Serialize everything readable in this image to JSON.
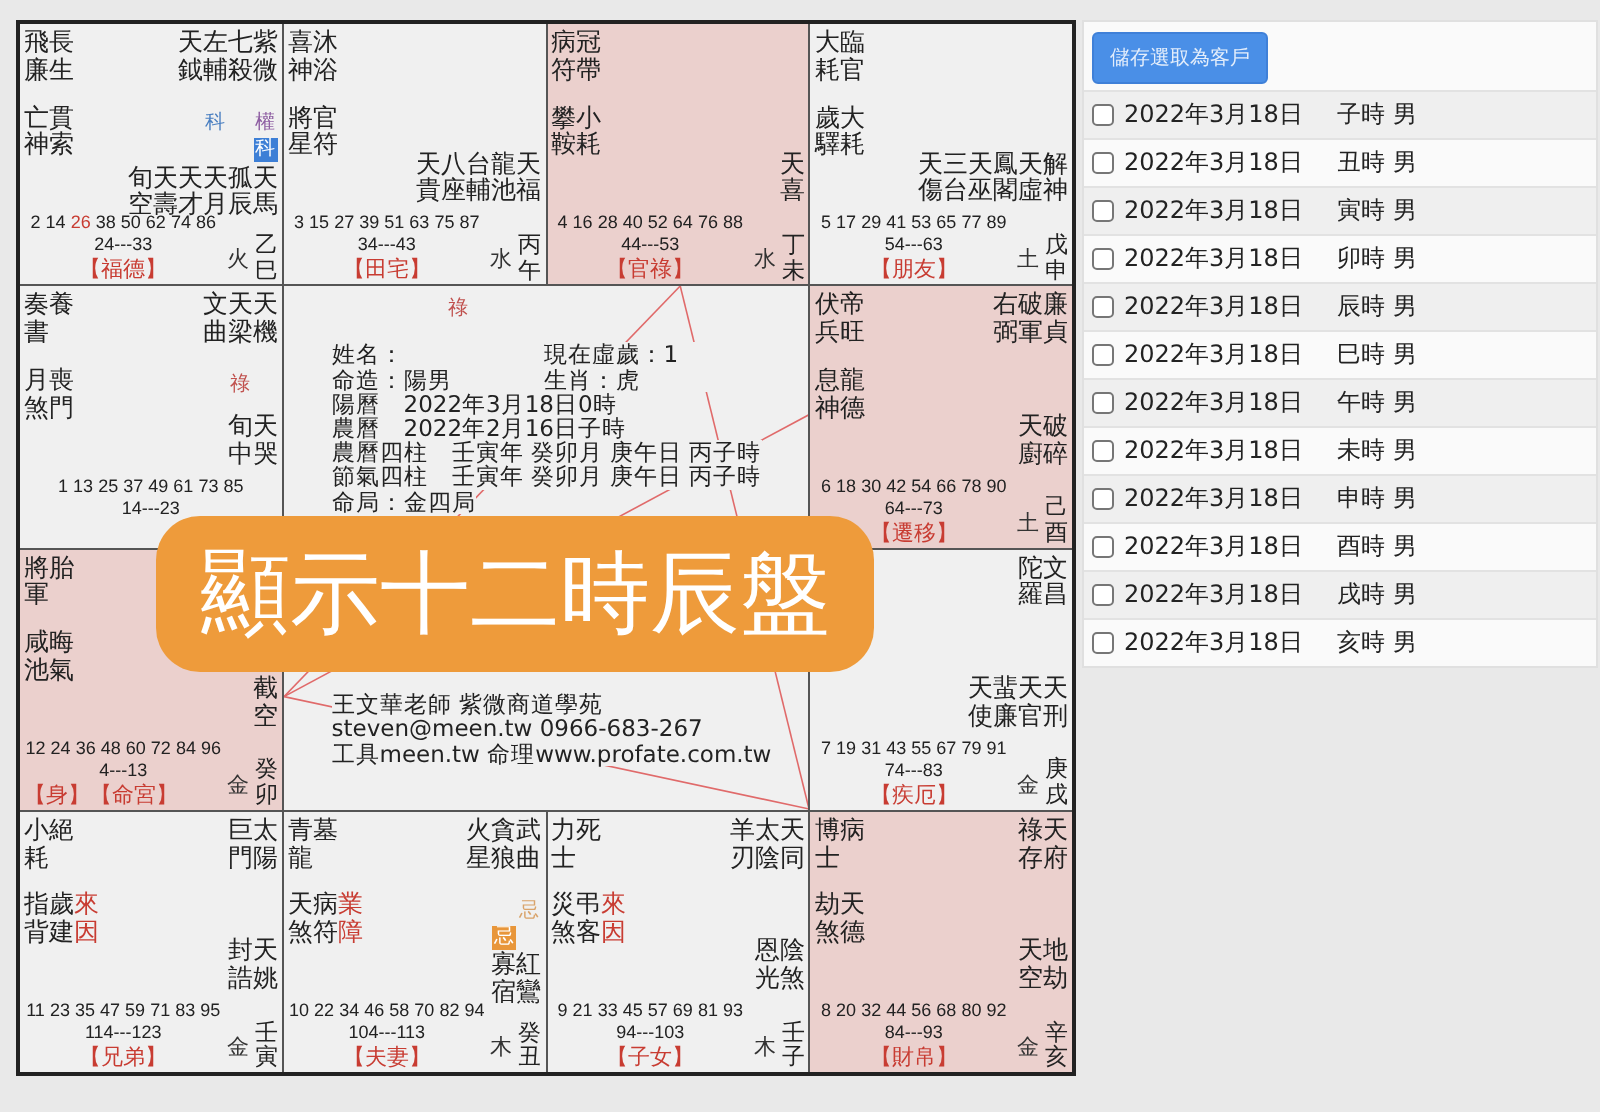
{
  "chart": {
    "palaces": [
      {
        "highlighted": false,
        "left_top": [
          "飛廉",
          "長生"
        ],
        "left_mid": [
          {
            "text": "亡神",
            "kind": "plain"
          },
          {
            "text": "貫索",
            "kind": "plain"
          }
        ],
        "main_stars": [
          {
            "name": "天鉞"
          },
          {
            "name": "左輔",
            "birth_mark": {
              "text": "科",
              "color": "#4a7fc1"
            }
          },
          {
            "name": "七殺"
          },
          {
            "name": "紫微",
            "birth_mark": {
              "text": "權",
              "color": "#8e5ea2"
            },
            "palace_mark": {
              "text": "科",
              "color": "#3d7fd6"
            }
          }
        ],
        "minor_stars": [
          "旬空",
          "天壽",
          "天才",
          "天月",
          "孤辰",
          "天馬"
        ],
        "ages": [
          {
            "text": "2",
            "current": false
          },
          {
            "text": "14",
            "current": false
          },
          {
            "text": "26",
            "current": true
          },
          {
            "text": "38",
            "current": false
          },
          {
            "text": "50",
            "current": false
          },
          {
            "text": "62",
            "current": false
          },
          {
            "text": "74",
            "current": false
          },
          {
            "text": "86",
            "current": false
          }
        ],
        "age_range": "24---33",
        "palace": "【福德】",
        "element": "火",
        "ganzhi": "乙巳"
      },
      {
        "highlighted": false,
        "left_top": [
          "喜神",
          "沐浴"
        ],
        "left_mid": [
          {
            "text": "將星",
            "kind": "plain"
          },
          {
            "text": "官符",
            "kind": "plain"
          }
        ],
        "minor_stars": [
          "天貴",
          "八座",
          "台輔",
          "龍池",
          "天福"
        ],
        "ages": [
          {
            "text": "3",
            "current": false
          },
          {
            "text": "15",
            "current": false
          },
          {
            "text": "27",
            "current": false
          },
          {
            "text": "39",
            "current": false
          },
          {
            "text": "51",
            "current": false
          },
          {
            "text": "63",
            "current": false
          },
          {
            "text": "75",
            "current": false
          },
          {
            "text": "87",
            "current": false
          }
        ],
        "age_range": "34---43",
        "palace": "【田宅】",
        "element": "水",
        "ganzhi": "丙午"
      },
      {
        "highlighted": true,
        "left_top": [
          "病符",
          "冠帶"
        ],
        "left_mid": [
          {
            "text": "攀鞍",
            "kind": "plain"
          },
          {
            "text": "小耗",
            "kind": "plain"
          }
        ],
        "minor_stars": [
          "天喜"
        ],
        "ages": [
          {
            "text": "4",
            "current": false
          },
          {
            "text": "16",
            "current": false
          },
          {
            "text": "28",
            "current": false
          },
          {
            "text": "40",
            "current": false
          },
          {
            "text": "52",
            "current": false
          },
          {
            "text": "64",
            "current": false
          },
          {
            "text": "76",
            "current": false
          },
          {
            "text": "88",
            "current": false
          }
        ],
        "age_range": "44---53",
        "palace": "【官祿】",
        "element": "水",
        "ganzhi": "丁未"
      },
      {
        "highlighted": false,
        "left_top": [
          "大耗",
          "臨官"
        ],
        "left_mid": [
          {
            "text": "歲驛",
            "kind": "plain"
          },
          {
            "text": "大耗",
            "kind": "plain"
          }
        ],
        "minor_stars": [
          "天傷",
          "三台",
          "天巫",
          "鳳閣",
          "天虛",
          "解神"
        ],
        "ages": [
          {
            "text": "5",
            "current": false
          },
          {
            "text": "17",
            "current": false
          },
          {
            "text": "29",
            "current": false
          },
          {
            "text": "41",
            "current": false
          },
          {
            "text": "53",
            "current": false
          },
          {
            "text": "65",
            "current": false
          },
          {
            "text": "77",
            "current": false
          },
          {
            "text": "89",
            "current": false
          }
        ],
        "age_range": "54---63",
        "palace": "【朋友】",
        "element": "土",
        "ganzhi": "戊申"
      },
      {
        "highlighted": false,
        "left_top": [
          "奏書",
          "養"
        ],
        "left_mid": [
          {
            "text": "月煞",
            "kind": "plain"
          },
          {
            "text": "喪門",
            "kind": "plain"
          }
        ],
        "main_stars": [
          {
            "name": "文曲"
          },
          {
            "name": "天梁",
            "birth_mark": {
              "text": "祿",
              "color": "#c0504d"
            }
          },
          {
            "name": "天機"
          }
        ],
        "minor_stars": [
          "旬中",
          "天哭"
        ],
        "ages": [
          {
            "text": "1",
            "current": false
          },
          {
            "text": "13",
            "current": false
          },
          {
            "text": "25",
            "current": false
          },
          {
            "text": "37",
            "current": false
          },
          {
            "text": "49",
            "current": false
          },
          {
            "text": "61",
            "current": false
          },
          {
            "text": "73",
            "current": false
          },
          {
            "text": "85",
            "current": false
          }
        ],
        "age_range": "14---23"
      },
      {
        "highlighted": true,
        "left_top": [
          "伏兵",
          "帝旺"
        ],
        "left_mid": [
          {
            "text": "息神",
            "kind": "plain"
          },
          {
            "text": "龍德",
            "kind": "plain"
          }
        ],
        "main_stars": [
          {
            "name": "右弼"
          },
          {
            "name": "破軍"
          },
          {
            "name": "廉貞"
          }
        ],
        "minor_stars": [
          "天廚",
          "破碎"
        ],
        "ages": [
          {
            "text": "6",
            "current": false
          },
          {
            "text": "18",
            "current": false
          },
          {
            "text": "30",
            "current": false
          },
          {
            "text": "42",
            "current": false
          },
          {
            "text": "54",
            "current": false
          },
          {
            "text": "66",
            "current": false
          },
          {
            "text": "78",
            "current": false
          },
          {
            "text": "90",
            "current": false
          }
        ],
        "age_range": "64---73",
        "palace": "【遷移】",
        "element": "土",
        "ganzhi": "己酉"
      },
      {
        "highlighted": true,
        "left_top": [
          "將軍",
          "胎"
        ],
        "left_mid": [
          {
            "text": "咸池",
            "kind": "plain"
          },
          {
            "text": "晦氣",
            "kind": "plain"
          }
        ],
        "minor_stars": [
          "截空"
        ],
        "ages": [
          {
            "text": "12",
            "current": false
          },
          {
            "text": "24",
            "current": false
          },
          {
            "text": "36",
            "current": false
          },
          {
            "text": "48",
            "current": false
          },
          {
            "text": "60",
            "current": false
          },
          {
            "text": "72",
            "current": false
          },
          {
            "text": "84",
            "current": false
          },
          {
            "text": "96",
            "current": false
          }
        ],
        "age_range": "4---13",
        "body_label": "【身】",
        "palace": "【命宮】",
        "element": "金",
        "ganzhi": "癸卯"
      },
      {
        "highlighted": false,
        "main_stars": [
          {
            "name": "陀羅"
          },
          {
            "name": "文昌"
          }
        ],
        "minor_stars": [
          "天使",
          "蜚廉",
          "天官",
          "天刑"
        ],
        "ages": [
          {
            "text": "7",
            "current": false
          },
          {
            "text": "19",
            "current": false
          },
          {
            "text": "31",
            "current": false
          },
          {
            "text": "43",
            "current": false
          },
          {
            "text": "55",
            "current": false
          },
          {
            "text": "67",
            "current": false
          },
          {
            "text": "79",
            "current": false
          },
          {
            "text": "91",
            "current": false
          }
        ],
        "age_range": "74---83",
        "palace": "【疾厄】",
        "element": "金",
        "ganzhi": "庚戌"
      },
      {
        "highlighted": false,
        "left_top": [
          "小耗",
          "絕"
        ],
        "left_mid": [
          {
            "text": "指背",
            "kind": "plain"
          },
          {
            "text": "歲建",
            "kind": "plain"
          },
          {
            "text": "來因",
            "kind": "cause"
          }
        ],
        "main_stars": [
          {
            "name": "巨門"
          },
          {
            "name": "太陽"
          }
        ],
        "minor_stars": [
          "封誥",
          "天姚"
        ],
        "ages": [
          {
            "text": "11",
            "current": false
          },
          {
            "text": "23",
            "current": false
          },
          {
            "text": "35",
            "current": false
          },
          {
            "text": "47",
            "current": false
          },
          {
            "text": "59",
            "current": false
          },
          {
            "text": "71",
            "current": false
          },
          {
            "text": "83",
            "current": false
          },
          {
            "text": "95",
            "current": false
          }
        ],
        "age_range": "114---123",
        "palace": "【兄弟】",
        "element": "金",
        "ganzhi": "壬寅"
      },
      {
        "highlighted": false,
        "left_top": [
          "青龍",
          "墓"
        ],
        "left_mid": [
          {
            "text": "天煞",
            "kind": "plain"
          },
          {
            "text": "病符",
            "kind": "plain"
          },
          {
            "text": "業障",
            "kind": "cause"
          }
        ],
        "main_stars": [
          {
            "name": "火星"
          },
          {
            "name": "貪狼",
            "palace_mark": {
              "text": "忌",
              "color": "#e8963a"
            }
          },
          {
            "name": "武曲",
            "birth_mark": {
              "text": "忌",
              "color": "#d9a36a"
            }
          }
        ],
        "minor_stars": [
          "寡宿",
          "紅鸞"
        ],
        "ages": [
          {
            "text": "10",
            "current": false
          },
          {
            "text": "22",
            "current": false
          },
          {
            "text": "34",
            "current": false
          },
          {
            "text": "46",
            "current": false
          },
          {
            "text": "58",
            "current": false
          },
          {
            "text": "70",
            "current": false
          },
          {
            "text": "82",
            "current": false
          },
          {
            "text": "94",
            "current": false
          }
        ],
        "age_range": "104---113",
        "palace": "【夫妻】",
        "element": "木",
        "ganzhi": "癸丑"
      },
      {
        "highlighted": false,
        "left_top": [
          "力士",
          "死"
        ],
        "left_mid": [
          {
            "text": "災煞",
            "kind": "plain"
          },
          {
            "text": "弔客",
            "kind": "plain"
          },
          {
            "text": "來因",
            "kind": "cause"
          }
        ],
        "main_stars": [
          {
            "name": "羊刃"
          },
          {
            "name": "太陰"
          },
          {
            "name": "天同"
          }
        ],
        "minor_stars": [
          "恩光",
          "陰煞"
        ],
        "ages": [
          {
            "text": "9",
            "current": false
          },
          {
            "text": "21",
            "current": false
          },
          {
            "text": "33",
            "current": false
          },
          {
            "text": "45",
            "current": false
          },
          {
            "text": "57",
            "current": false
          },
          {
            "text": "69",
            "current": false
          },
          {
            "text": "81",
            "current": false
          },
          {
            "text": "93",
            "current": false
          }
        ],
        "age_range": "94---103",
        "palace": "【子女】",
        "element": "木",
        "ganzhi": "壬子"
      },
      {
        "highlighted": true,
        "left_top": [
          "博士",
          "病"
        ],
        "left_mid": [
          {
            "text": "劫煞",
            "kind": "plain"
          },
          {
            "text": "天德",
            "kind": "plain"
          }
        ],
        "main_stars": [
          {
            "name": "祿存"
          },
          {
            "name": "天府"
          }
        ],
        "minor_stars": [
          "天空",
          "地劫"
        ],
        "ages": [
          {
            "text": "8",
            "current": false
          },
          {
            "text": "20",
            "current": false
          },
          {
            "text": "32",
            "current": false
          },
          {
            "text": "44",
            "current": false
          },
          {
            "text": "56",
            "current": false
          },
          {
            "text": "68",
            "current": false
          },
          {
            "text": "80",
            "current": false
          },
          {
            "text": "92",
            "current": false
          }
        ],
        "age_range": "84---93",
        "palace": "【財帛】",
        "element": "金",
        "ganzhi": "辛亥"
      }
    ],
    "center": {
      "top_mark": "祿",
      "header_pairs": [
        {
          "left": "姓名：",
          "right": "現在虛歲：1"
        },
        {
          "left": "命造：陽男",
          "right": "生肖：虎"
        }
      ],
      "details": [
        {
          "label": "陽曆",
          "value": "2022年3月18日0時"
        },
        {
          "label": "農曆",
          "value": "2022年2月16日子時"
        },
        {
          "label": "農曆四柱",
          "value": "壬寅年 癸卯月 庚午日 丙子時"
        },
        {
          "label": "節氣四柱",
          "value": "壬寅年 癸卯月 庚午日 丙子時"
        }
      ],
      "bureau": "命局：金四局",
      "footer": [
        "王文華老師 紫微商道學苑",
        "steven@meen.tw 0966-683-267",
        "工具meen.tw 命理www.profate.com.tw"
      ]
    },
    "banner": "顯示十二時辰盤"
  },
  "side_panel": {
    "save_button": "儲存選取為客戶",
    "rows": [
      {
        "date": "2022年3月18日",
        "hour": "子時 男",
        "checked": false
      },
      {
        "date": "2022年3月18日",
        "hour": "丑時 男",
        "checked": false
      },
      {
        "date": "2022年3月18日",
        "hour": "寅時 男",
        "checked": false
      },
      {
        "date": "2022年3月18日",
        "hour": "卯時 男",
        "checked": false
      },
      {
        "date": "2022年3月18日",
        "hour": "辰時 男",
        "checked": false
      },
      {
        "date": "2022年3月18日",
        "hour": "巳時 男",
        "checked": false
      },
      {
        "date": "2022年3月18日",
        "hour": "午時 男",
        "checked": false
      },
      {
        "date": "2022年3月18日",
        "hour": "未時 男",
        "checked": false
      },
      {
        "date": "2022年3月18日",
        "hour": "申時 男",
        "checked": false
      },
      {
        "date": "2022年3月18日",
        "hour": "酉時 男",
        "checked": false
      },
      {
        "date": "2022年3月18日",
        "hour": "戌時 男",
        "checked": false
      },
      {
        "date": "2022年3月18日",
        "hour": "亥時 男",
        "checked": false
      }
    ]
  }
}
